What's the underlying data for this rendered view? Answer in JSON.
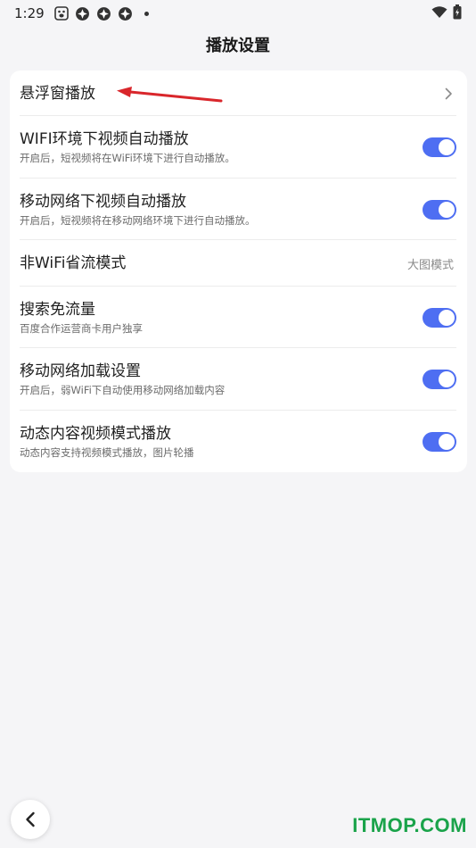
{
  "status_bar": {
    "time": "1:29",
    "left_icons": [
      "baidu-paw-icon",
      "app-icon",
      "app-icon",
      "app-icon"
    ],
    "right_icons": [
      "wifi-icon",
      "battery-icon"
    ]
  },
  "header": {
    "title": "播放设置"
  },
  "settings": {
    "items": [
      {
        "title": "悬浮窗播放",
        "type": "link"
      },
      {
        "title": "WIFI环境下视频自动播放",
        "subtitle": "开启后，短视频将在WiFi环境下进行自动播放。",
        "type": "toggle",
        "on": true
      },
      {
        "title": "移动网络下视频自动播放",
        "subtitle": "开启后，短视频将在移动网络环境下进行自动播放。",
        "type": "toggle",
        "on": true
      },
      {
        "title": "非WiFi省流模式",
        "value": "大图模式",
        "type": "value"
      },
      {
        "title": "搜索免流量",
        "subtitle": "百度合作运营商卡用户独享",
        "type": "toggle",
        "on": true
      },
      {
        "title": "移动网络加载设置",
        "subtitle": "开启后，弱WiFi下自动使用移动网络加载内容",
        "type": "toggle",
        "on": true
      },
      {
        "title": "动态内容视频模式播放",
        "subtitle": "动态内容支持视频模式播放，图片轮播",
        "type": "toggle",
        "on": true
      }
    ]
  },
  "watermark": "ITMOP.COM",
  "colors": {
    "accent": "#4e6ef2",
    "annotation": "#d9262b",
    "watermark": "#1aa34a"
  }
}
